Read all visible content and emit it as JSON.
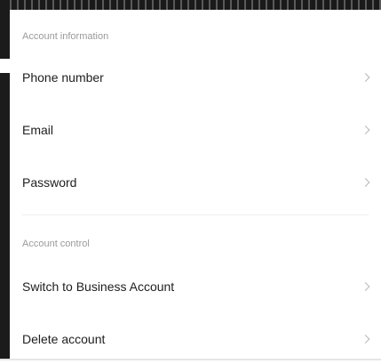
{
  "sections": [
    {
      "header": "Account information",
      "items": [
        {
          "label": "Phone number",
          "icon": "chevron-right-icon"
        },
        {
          "label": "Email",
          "icon": "chevron-right-icon"
        },
        {
          "label": "Password",
          "icon": "chevron-right-icon"
        }
      ]
    },
    {
      "header": "Account control",
      "items": [
        {
          "label": "Switch to Business Account",
          "icon": "chevron-right-icon"
        },
        {
          "label": "Delete account",
          "icon": "chevron-right-icon"
        }
      ]
    }
  ]
}
